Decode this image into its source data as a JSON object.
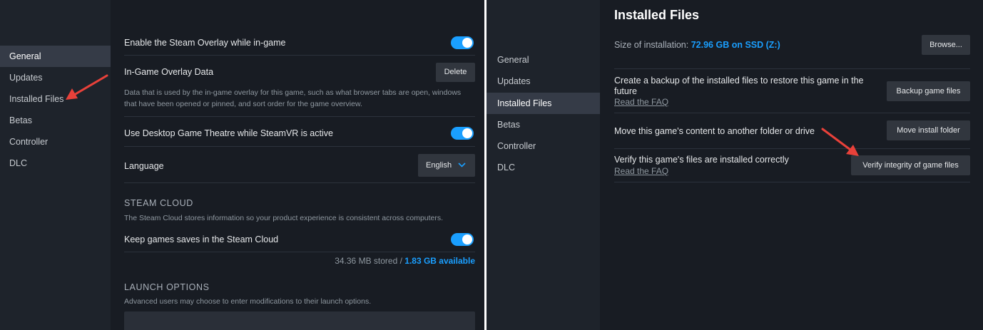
{
  "left": {
    "sidebar": {
      "items": [
        {
          "label": "General",
          "active": true
        },
        {
          "label": "Updates"
        },
        {
          "label": "Installed Files"
        },
        {
          "label": "Betas"
        },
        {
          "label": "Controller"
        },
        {
          "label": "DLC"
        }
      ]
    },
    "general": {
      "overlay_label": "Enable the Steam Overlay while in-game",
      "overlay_enabled": true,
      "overlay_data_label": "In-Game Overlay Data",
      "delete_label": "Delete",
      "overlay_data_desc": "Data that is used by the in-game overlay for this game, such as what browser tabs are open, windows that have been opened or pinned, and sort order for the game overview.",
      "theatre_label": "Use Desktop Game Theatre while SteamVR is active",
      "theatre_enabled": true,
      "language_label": "Language",
      "language_value": "English"
    },
    "cloud": {
      "header": "STEAM CLOUD",
      "desc": "The Steam Cloud stores information so your product experience is consistent across computers.",
      "keep_label": "Keep games saves in the Steam Cloud",
      "keep_enabled": true,
      "stored": "34.36 MB stored /",
      "available": "1.83 GB available"
    },
    "launch": {
      "header": "LAUNCH OPTIONS",
      "desc": "Advanced users may choose to enter modifications to their launch options.",
      "value": ""
    }
  },
  "right": {
    "sidebar": {
      "items": [
        {
          "label": "General"
        },
        {
          "label": "Updates"
        },
        {
          "label": "Installed Files",
          "active": true
        },
        {
          "label": "Betas"
        },
        {
          "label": "Controller"
        },
        {
          "label": "DLC"
        }
      ]
    },
    "installed": {
      "title": "Installed Files",
      "size_label": "Size of installation:",
      "size_value": "72.96 GB on SSD (Z:)",
      "browse_label": "Browse...",
      "backup_text": "Create a backup of the installed files to restore this game in the future",
      "backup_faq": "Read the FAQ",
      "backup_button": "Backup game files",
      "move_text": "Move this game's content to another folder or drive",
      "move_button": "Move install folder",
      "verify_text": "Verify this game's files are installed correctly",
      "verify_faq": "Read the FAQ",
      "verify_button": "Verify integrity of game files"
    }
  },
  "colors": {
    "accent": "#1a9fff",
    "annotation_arrow": "#e8413a"
  }
}
